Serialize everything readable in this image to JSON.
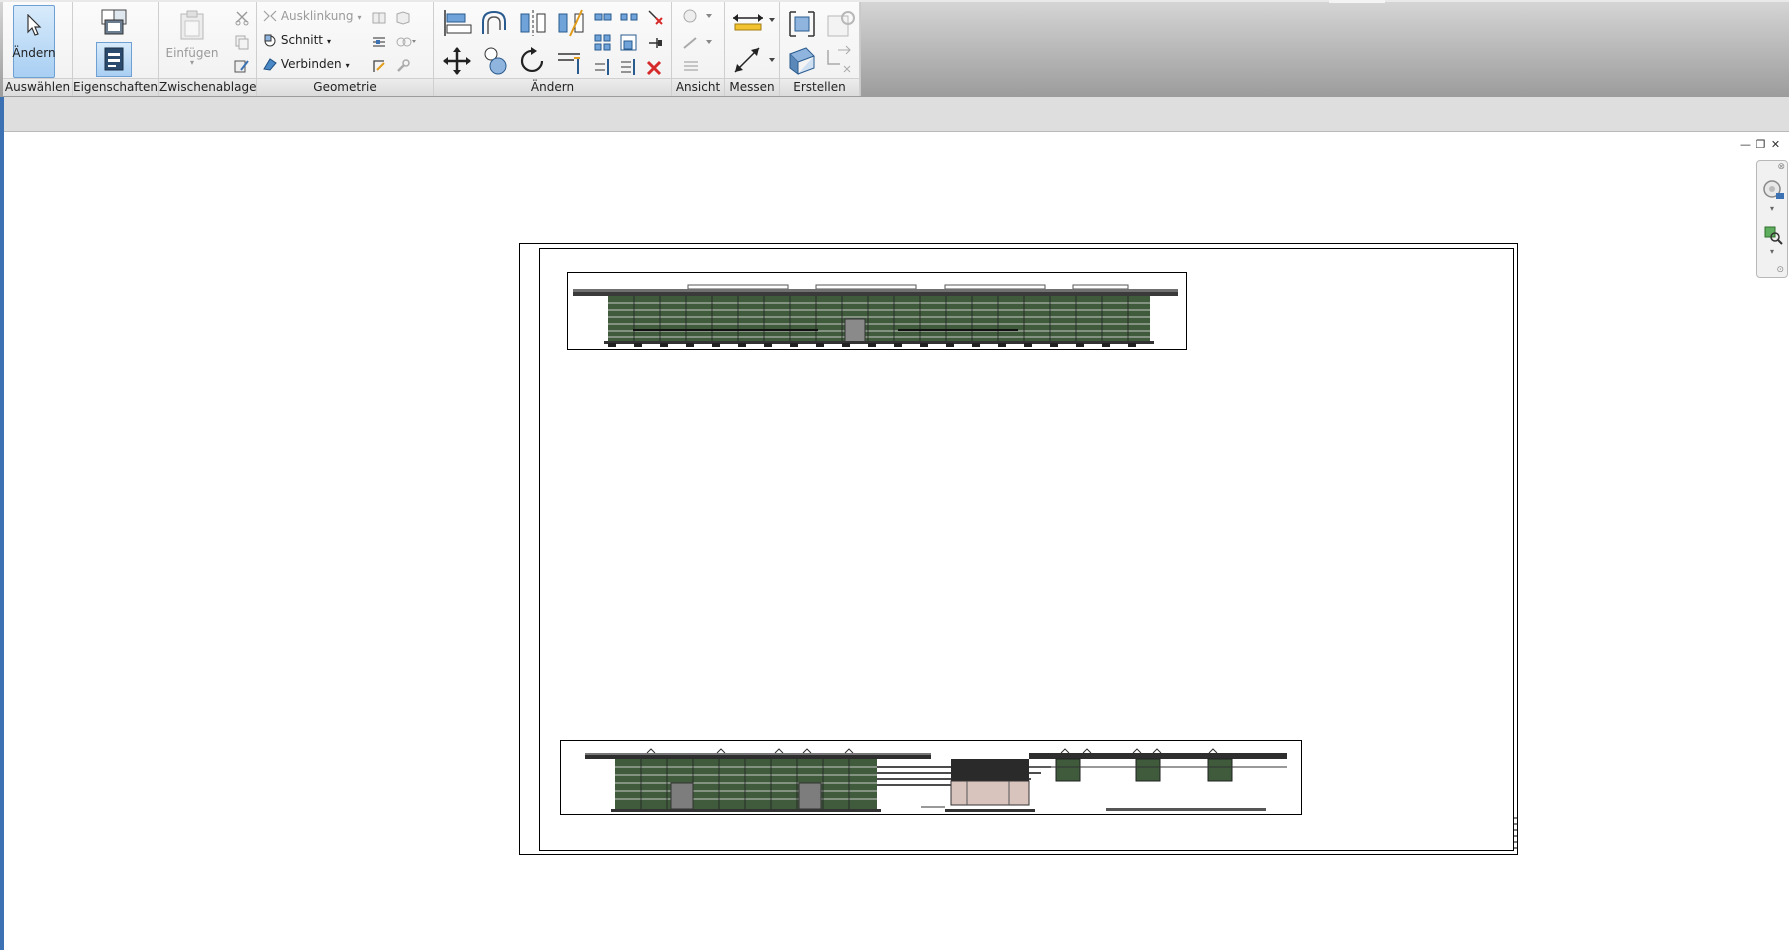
{
  "ribbon": {
    "panels": {
      "select": "Auswählen",
      "properties": "Eigenschaften",
      "clipboard": "Zwischenablage",
      "geometry": "Geometrie",
      "modify": "Ändern",
      "view": "Ansicht",
      "measure": "Messen",
      "create": "Erstellen"
    },
    "modify_button": "Ändern",
    "paste_button": "Einfügen",
    "cope_button": "Ausklinkung",
    "cut_geometry_button": "Schnitt",
    "join_button": "Verbinden"
  },
  "colors": {
    "accent": "#3c72b4",
    "ribbon_bg": "#f4f4f4",
    "facade_green": "#3f5b3c",
    "delete_red": "#d62a2a"
  },
  "window_controls": {
    "minimize": "—",
    "restore": "❐",
    "close": "✕"
  }
}
